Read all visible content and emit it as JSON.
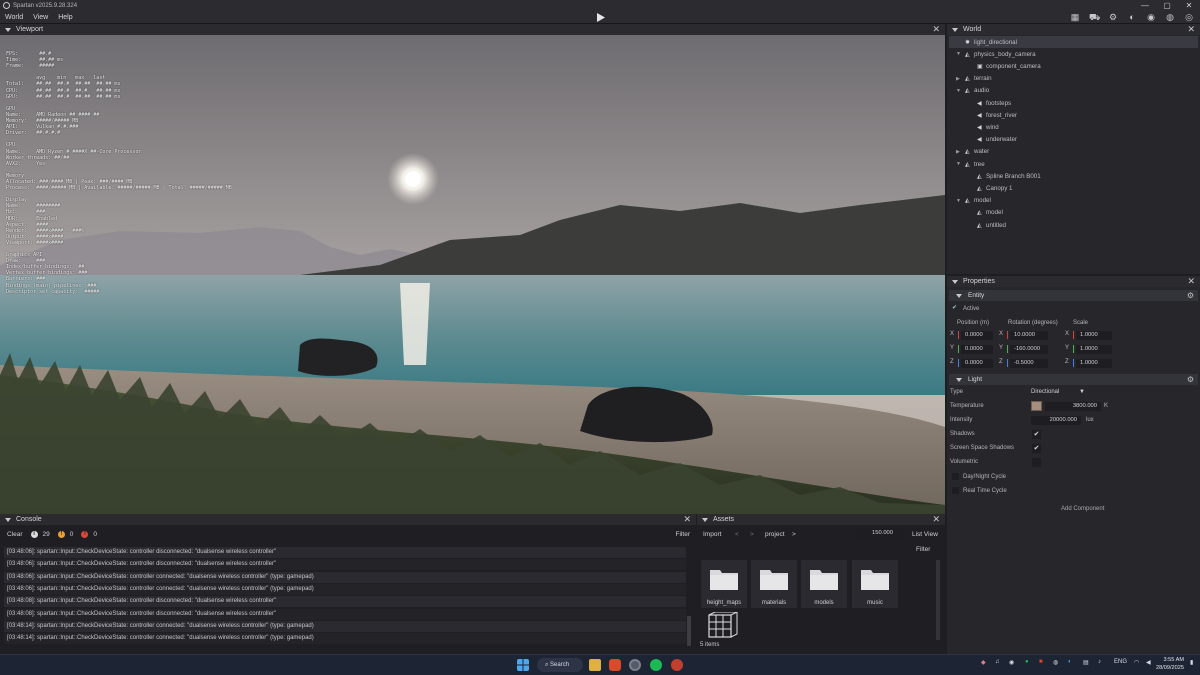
{
  "titlebar": {
    "title": "Spartan v2025.9.28.324",
    "controls": [
      "—",
      "▢",
      "✕"
    ]
  },
  "menu": {
    "items": [
      "World",
      "View",
      "Help"
    ],
    "tool_icons": [
      "grid-icon",
      "car-icon",
      "gear-icon",
      "circle-icon",
      "camera-icon",
      "sphere-icon",
      "globe-icon"
    ]
  },
  "viewport": {
    "title": "Viewport",
    "stats": "FPS:       ##.#\nTime:      ##.## ms\nFrame:     #####\n\n          avg    min   max   last\nTotal:    ##.##  ##.#  ##.##  ##.## ms\nCPU:      ##.##  ##.#  ##.#   ##.## ms\nGPU:      ##.##  ##.#  ##.##  ##.## ms\n\nGPU\nName:     AMD Radeon ## #### ##\nMemory:   #####/##### MB\nAPI:      Vulkan #.#.###\nDriver:   ##.#.#.#\n\nCPU\nName:     AMD Ryzen # ####X ##-Core Processor\nWorker threads: ##/##\nAVX2:     Yes\n\nMemory\nAllocated: ###/#### MB | Peak: ###/#### MB\nProcess:  ####/##### MB | Available: #####/##### MB | Total: #####/##### MB\n\nDisplay\nName:     ########\nHz:       ###\nHDR:      Enabled\nAspect:   ####\nRender:   ####x#### - ###%\nOutput:   ####x####\nViewport: ####x####\n\nGraphics API\nDraw:     ###\nIndex/buffer bindings:  ##\nVertex buffer bindings: ###\nBarriers: ###\nBindings (main) pipelines: ###\nDescriptor set capacity:  #####"
  },
  "world": {
    "title": "World",
    "items": [
      {
        "label": "light_directional",
        "depth": 1,
        "icon": "light",
        "expand": "",
        "selected": true
      },
      {
        "label": "physics_body_camera",
        "depth": 1,
        "icon": "entity",
        "expand": "▼"
      },
      {
        "label": "component_camera",
        "depth": 2,
        "icon": "camera",
        "expand": ""
      },
      {
        "label": "terrain",
        "depth": 1,
        "icon": "entity",
        "expand": "▶"
      },
      {
        "label": "audio",
        "depth": 1,
        "icon": "entity",
        "expand": "▼"
      },
      {
        "label": "footsteps",
        "depth": 2,
        "icon": "audio",
        "expand": ""
      },
      {
        "label": "forest_river",
        "depth": 2,
        "icon": "audio",
        "expand": ""
      },
      {
        "label": "wind",
        "depth": 2,
        "icon": "audio",
        "expand": ""
      },
      {
        "label": "underwater",
        "depth": 2,
        "icon": "audio",
        "expand": ""
      },
      {
        "label": "water",
        "depth": 1,
        "icon": "entity",
        "expand": "▶"
      },
      {
        "label": "tree",
        "depth": 1,
        "icon": "entity",
        "expand": "▼"
      },
      {
        "label": "Spline Branch B001",
        "depth": 2,
        "icon": "entity",
        "expand": ""
      },
      {
        "label": "Canopy 1",
        "depth": 2,
        "icon": "entity",
        "expand": ""
      },
      {
        "label": "model",
        "depth": 1,
        "icon": "entity",
        "expand": "▼"
      },
      {
        "label": "model",
        "depth": 2,
        "icon": "entity",
        "expand": ""
      },
      {
        "label": "untitled",
        "depth": 2,
        "icon": "entity",
        "expand": ""
      }
    ]
  },
  "properties": {
    "title": "Properties",
    "entity": {
      "section": "Entity",
      "active_label": "Active",
      "position_label": "Position (m)",
      "rotation_label": "Rotation (degrees)",
      "scale_label": "Scale",
      "axes": [
        "X",
        "Y",
        "Z"
      ],
      "position": [
        "0.0000",
        "0.0000",
        "0.0000"
      ],
      "rotation": [
        "10.0000",
        "-160.0000",
        "-0.5000"
      ],
      "scale": [
        "1.0000",
        "1.0000",
        "1.0000"
      ]
    },
    "light": {
      "section": "Light",
      "type_label": "Type",
      "type_value": "Directional",
      "temperature_label": "Temperature",
      "temperature_value": "3800.000",
      "temperature_unit": "K",
      "intensity_label": "Intensity",
      "intensity_value": "20000.000",
      "intensity_unit": "lux",
      "shadows_label": "Shadows",
      "screen_space_shadows_label": "Screen Space Shadows",
      "volumetric_label": "Volumetric",
      "day_night_label": "Day/Night Cycle",
      "real_time_label": "Real Time Cycle",
      "add_component": "Add Component",
      "swatch_color": "#a58e7b"
    }
  },
  "console": {
    "title": "Console",
    "clear": "Clear",
    "info_count": "29",
    "warning_count": "0",
    "error_count": "0",
    "filter": "Filter",
    "lines": [
      "[03:48:06]: spartan::Input::CheckDeviceState: controller disconnected: \"dualsense wireless controller\"",
      "[03:48:06]: spartan::Input::CheckDeviceState: controller disconnected: \"dualsense wireless controller\"",
      "[03:48:06]: spartan::Input::CheckDeviceState: controller connected: \"dualsense wireless controller\" (type: gamepad)",
      "[03:48:06]: spartan::Input::CheckDeviceState: controller connected: \"dualsense wireless controller\" (type: gamepad)",
      "[03:48:08]: spartan::Input::CheckDeviceState: controller disconnected: \"dualsense wireless controller\"",
      "[03:48:08]: spartan::Input::CheckDeviceState: controller disconnected: \"dualsense wireless controller\"",
      "[03:48:14]: spartan::Input::CheckDeviceState: controller connected: \"dualsense wireless controller\" (type: gamepad)",
      "[03:48:14]: spartan::Input::CheckDeviceState: controller connected: \"dualsense wireless controller\" (type: gamepad)"
    ]
  },
  "assets": {
    "title": "Assets",
    "import": "Import",
    "back": "<",
    "forward": ">",
    "path": "project",
    "path_sep": ">",
    "zoom": "150.000",
    "list_view": "List View",
    "filter": "Filter",
    "folders": [
      "height_maps",
      "materials",
      "models",
      "music"
    ],
    "item_count": "5 items"
  },
  "taskbar": {
    "search": "Search",
    "language": "ENG",
    "time": "3:55 AM",
    "date": "28/09/2025"
  }
}
